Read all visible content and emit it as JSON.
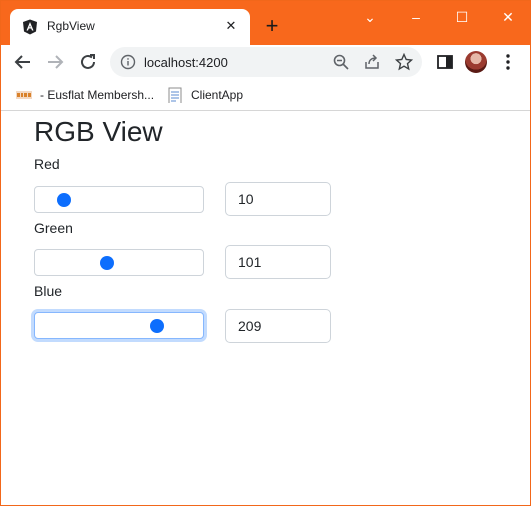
{
  "browser": {
    "tab_title": "RgbView",
    "url": "localhost:4200",
    "new_tab_symbol": "+",
    "window_controls": {
      "minimize": "–",
      "restore": "☐",
      "close": "✕",
      "dropdown": "⌄"
    },
    "bookmarks": [
      {
        "label": "- Eusflat Membersh...",
        "icon": "eusflat-favicon"
      },
      {
        "label": "ClientApp",
        "icon": "document-icon"
      }
    ],
    "colors": {
      "titlebar": "#f8681c",
      "accent": "#0d6efd"
    }
  },
  "page": {
    "title": "RGB View",
    "fields": [
      {
        "label": "Red",
        "value": "10",
        "slider_fraction": 0.04
      },
      {
        "label": "Green",
        "value": "101",
        "slider_fraction": 0.4
      },
      {
        "label": "Blue",
        "value": "209",
        "slider_fraction": 0.82
      }
    ],
    "slider_range": [
      0,
      255
    ]
  }
}
